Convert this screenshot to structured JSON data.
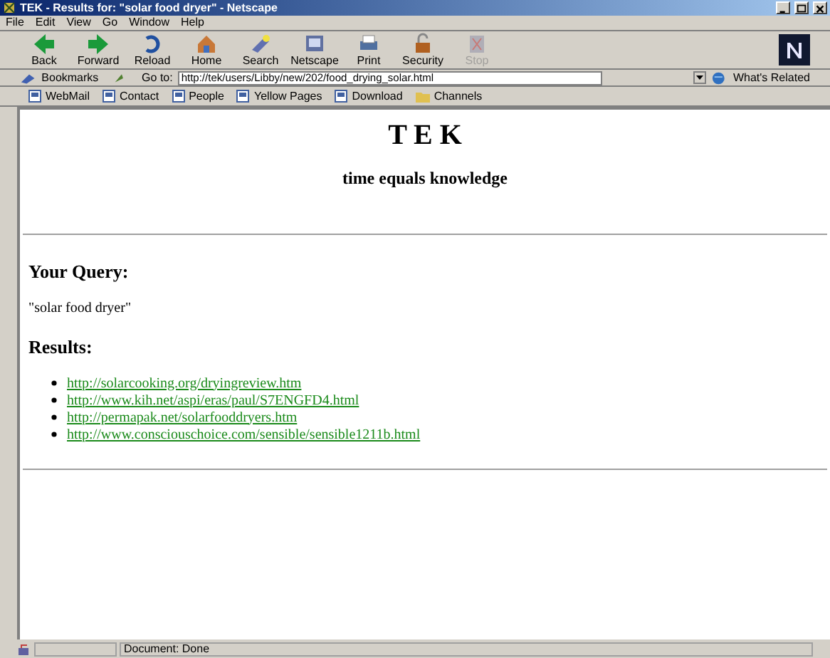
{
  "window": {
    "title": "TEK - Results for: \"solar food dryer\" - Netscape"
  },
  "menu": [
    "File",
    "Edit",
    "View",
    "Go",
    "Window",
    "Help"
  ],
  "toolbar": [
    {
      "label": "Back",
      "disabled": false
    },
    {
      "label": "Forward",
      "disabled": false
    },
    {
      "label": "Reload",
      "disabled": false
    },
    {
      "label": "Home",
      "disabled": false
    },
    {
      "label": "Search",
      "disabled": false
    },
    {
      "label": "Netscape",
      "disabled": false
    },
    {
      "label": "Print",
      "disabled": false
    },
    {
      "label": "Security",
      "disabled": false
    },
    {
      "label": "Stop",
      "disabled": true
    }
  ],
  "location": {
    "bookmarks": "Bookmarks",
    "goto_label": "Go to:",
    "url": "http://tek/users/Libby/new/202/food_drying_solar.html",
    "related": "What's Related"
  },
  "personal_toolbar": [
    {
      "label": "WebMail",
      "kind": "page"
    },
    {
      "label": "Contact",
      "kind": "page"
    },
    {
      "label": "People",
      "kind": "page"
    },
    {
      "label": "Yellow Pages",
      "kind": "page"
    },
    {
      "label": "Download",
      "kind": "page"
    },
    {
      "label": "Channels",
      "kind": "folder"
    }
  ],
  "page": {
    "title": "T E K",
    "subtitle": "time equals knowledge",
    "query_heading": "Your Query:",
    "query": "\"solar food dryer\"",
    "results_heading": "Results:",
    "results": [
      "http://solarcooking.org/dryingreview.htm",
      "http://www.kih.net/aspi/eras/paul/S7ENGFD4.html",
      "http://permapak.net/solarfooddryers.htm",
      "http://www.consciouschoice.com/sensible/sensible1211b.html"
    ]
  },
  "status_bar": {
    "text": "Document: Done"
  }
}
